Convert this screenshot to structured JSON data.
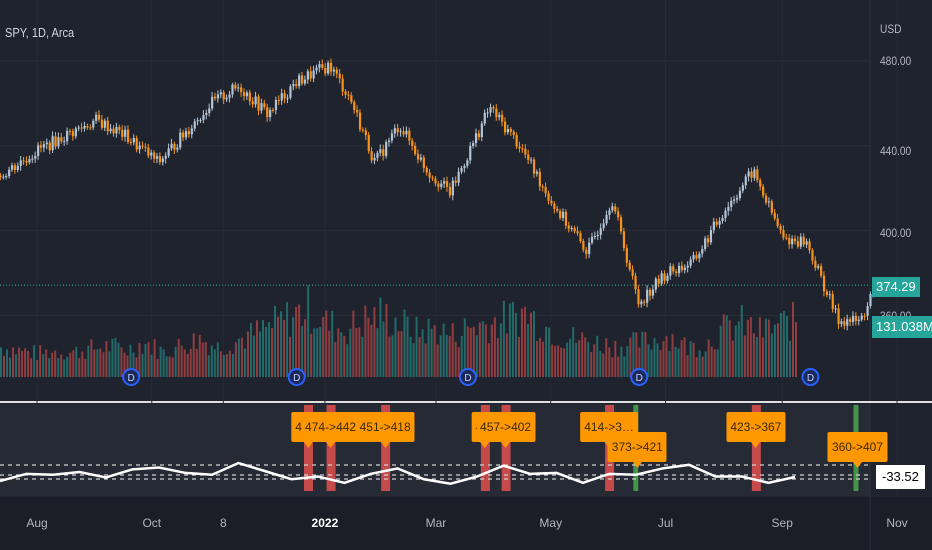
{
  "header": {
    "symbol_title": "SPY, 1D, Arca"
  },
  "price_axis": {
    "currency": "USD",
    "last_price": "374.29",
    "last_volume": "131.038M",
    "oscillator_value": "-33.52"
  },
  "colors": {
    "up": "#b2c5d6",
    "down": "#f7931a",
    "vol_up": "#26a69a",
    "vol_down": "#ef5350",
    "signal": "#ff9800",
    "last_price_tag": "#26a69a",
    "sell_band": "#ef5350",
    "buy_band": "#4caf50"
  },
  "chart_data": {
    "type": "line",
    "title": "SPY, 1D, Arca",
    "ylabel": "USD",
    "ylim": [
      340,
      490
    ],
    "y_ticks": [
      "480.00",
      "440.00",
      "400.00",
      "360.00"
    ],
    "x_ticks": [
      {
        "label": "Aug",
        "date": "2021-08-01"
      },
      {
        "label": "Oct",
        "date": "2021-10-01"
      },
      {
        "label": "8",
        "date": "2021-11-08"
      },
      {
        "label": "2022",
        "date": "2022-01-01"
      },
      {
        "label": "Mar",
        "date": "2022-03-01"
      },
      {
        "label": "May",
        "date": "2022-05-01"
      },
      {
        "label": "Jul",
        "date": "2022-07-01"
      },
      {
        "label": "Sep",
        "date": "2022-09-01"
      },
      {
        "label": "Nov",
        "date": "2022-11-01"
      }
    ],
    "price_series": [
      [
        "2021-07-12",
        426
      ],
      [
        "2021-08-01",
        438
      ],
      [
        "2021-08-16",
        445
      ],
      [
        "2021-09-01",
        452
      ],
      [
        "2021-09-16",
        445
      ],
      [
        "2021-10-04",
        432
      ],
      [
        "2021-10-18",
        446
      ],
      [
        "2021-11-01",
        460
      ],
      [
        "2021-11-16",
        468
      ],
      [
        "2021-12-01",
        455
      ],
      [
        "2021-12-16",
        470
      ],
      [
        "2022-01-03",
        478
      ],
      [
        "2022-01-14",
        462
      ],
      [
        "2022-01-27",
        432
      ],
      [
        "2022-02-09",
        450
      ],
      [
        "2022-02-24",
        428
      ],
      [
        "2022-03-08",
        418
      ],
      [
        "2022-03-29",
        458
      ],
      [
        "2022-04-14",
        440
      ],
      [
        "2022-05-02",
        412
      ],
      [
        "2022-05-20",
        390
      ],
      [
        "2022-06-02",
        415
      ],
      [
        "2022-06-16",
        366
      ],
      [
        "2022-07-01",
        380
      ],
      [
        "2022-07-15",
        385
      ],
      [
        "2022-08-01",
        410
      ],
      [
        "2022-08-16",
        428
      ],
      [
        "2022-09-01",
        396
      ],
      [
        "2022-09-13",
        395
      ],
      [
        "2022-09-30",
        358
      ],
      [
        "2022-10-12",
        357
      ],
      [
        "2022-10-20",
        374.29
      ]
    ],
    "volume_series": [
      70,
      62,
      55,
      60,
      58,
      66,
      72,
      64,
      80,
      58,
      74,
      90,
      70,
      85,
      100,
      120,
      140,
      160,
      125,
      110,
      130,
      145,
      128,
      105,
      112,
      98,
      118,
      125,
      135,
      150,
      122,
      96,
      88,
      80,
      72,
      78,
      85,
      96,
      70,
      75,
      110,
      125,
      105,
      120,
      131
    ],
    "oscillator_series": [
      -38,
      -30,
      -31,
      -28,
      -34,
      -25,
      -23,
      -29,
      -31,
      -18,
      -27,
      -36,
      -33,
      -40,
      -30,
      -24,
      -36,
      -41,
      -33,
      -21,
      -30,
      -29,
      -40,
      -30,
      -31,
      -24,
      -20,
      -33,
      -33,
      -40,
      -33.52
    ],
    "signals": [
      {
        "label": "47…",
        "date": "2021-12-23",
        "type": "sell",
        "row": 0
      },
      {
        "label": "474->442",
        "date": "2022-01-04",
        "type": "sell",
        "row": 0
      },
      {
        "label": "451->418",
        "date": "2022-02-02",
        "type": "sell",
        "row": 0
      },
      {
        "label": "4…",
        "date": "2022-03-27",
        "type": "sell",
        "row": 0
      },
      {
        "label": "457->402",
        "date": "2022-04-07",
        "type": "sell",
        "row": 0
      },
      {
        "label": "414->3…",
        "date": "2022-06-01",
        "type": "sell",
        "row": 0
      },
      {
        "label": "373->421",
        "date": "2022-06-16",
        "type": "buy",
        "row": 1
      },
      {
        "label": "423->367",
        "date": "2022-08-18",
        "type": "sell",
        "row": 0
      },
      {
        "label": "360->407",
        "date": "2022-10-11",
        "type": "buy",
        "row": 1
      }
    ],
    "dividend_markers": [
      "2021-09-20",
      "2021-12-17",
      "2022-03-18",
      "2022-06-17",
      "2022-09-16"
    ]
  }
}
